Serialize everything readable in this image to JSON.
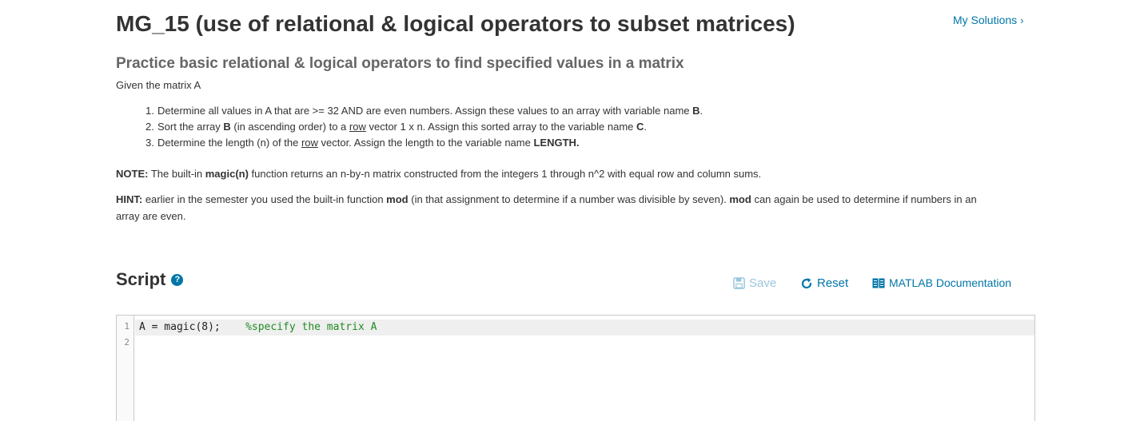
{
  "header": {
    "title": "MG_15 (use of relational & logical operators to subset matrices)",
    "my_solutions": "My Solutions"
  },
  "problem": {
    "subtitle": "Practice basic relational & logical operators to find specified values in a matrix",
    "given": "Given the matrix A",
    "steps": [
      {
        "num": "1.",
        "a": "Determine all values in A  that are >= 32   AND are even numbers.   Assign these values to an array with variable name ",
        "b": "B",
        "c": "."
      },
      {
        "num": "2.",
        "a": "Sort the array ",
        "b": "B",
        "c": " (in ascending order) to a ",
        "u": "row",
        "d": " vector   1 x n.  Assign this sorted array to the variable name ",
        "e": "C",
        "f": "."
      },
      {
        "num": "3.",
        "a": "Determine the length (n) of the ",
        "u": "row",
        "b": " vector.  Assign the length to the variable name ",
        "c": "LENGTH."
      }
    ],
    "note": {
      "label": "NOTE:",
      "a": " The built-in ",
      "fn": "magic(n)",
      "b": " function returns an n-by-n matrix constructed from the integers 1 through n^2 with equal row and column sums."
    },
    "hint": {
      "label": "HINT:",
      "a": " earlier in the semester you used the built-in function ",
      "fn1": "mod",
      "b": " (in that assignment to determine if a number was divisible by seven).    ",
      "fn2": "mod",
      "c": " can again be used to determine if numbers in an array are even."
    }
  },
  "script": {
    "heading": "Script",
    "help_icon": "question-circle-icon",
    "toolbar": {
      "save_label": "Save",
      "reset_label": "Reset",
      "doc_label": "MATLAB Documentation"
    },
    "editor": {
      "lines": [
        {
          "num": "1",
          "code": "A = magic(8);    ",
          "comment": "%specify the matrix A"
        },
        {
          "num": "2",
          "code": "",
          "comment": ""
        }
      ]
    }
  },
  "colors": {
    "link": "#0076a8",
    "save_disabled": "#9ac6de",
    "comment": "#228b22"
  }
}
